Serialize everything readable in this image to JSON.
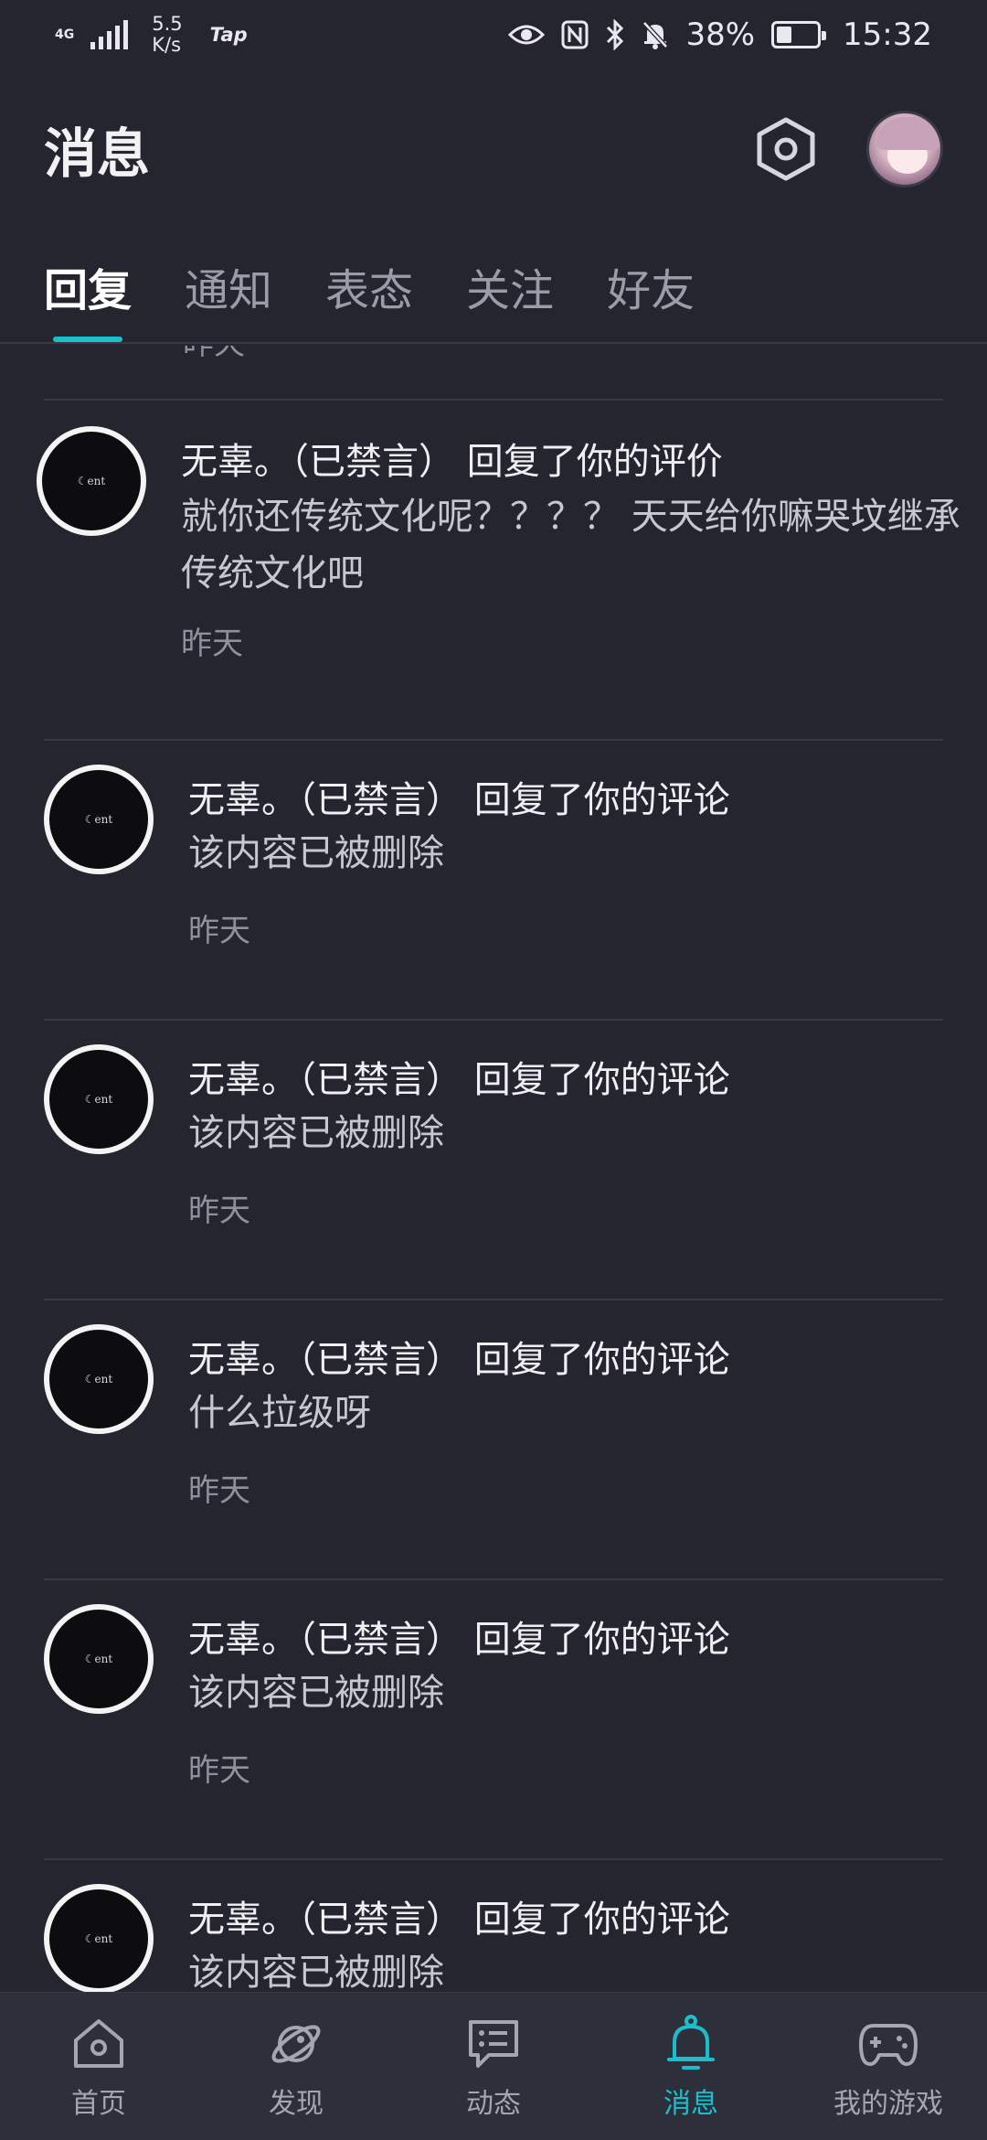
{
  "status_bar": {
    "network": "4G",
    "speed_value": "5.5",
    "speed_unit": "K/s",
    "app_badge": "Tap",
    "battery_percent": "38%",
    "battery_level": 0.38,
    "time": "15:32"
  },
  "header": {
    "title": "消息"
  },
  "tabs": [
    {
      "label": "回复",
      "active": true
    },
    {
      "label": "通知",
      "active": false
    },
    {
      "label": "表态",
      "active": false
    },
    {
      "label": "关注",
      "active": false
    },
    {
      "label": "好友",
      "active": false
    }
  ],
  "list": {
    "partial_time": "昨天",
    "items": [
      {
        "title": "无辜。（已禁言） 回复了你的评价",
        "body": "就你还传统文化呢？？？？ 天天给你嘛哭坟继承传统文化吧",
        "time": "昨天"
      },
      {
        "title": "无辜。（已禁言） 回复了你的评论",
        "body": "该内容已被删除",
        "time": "昨天"
      },
      {
        "title": "无辜。（已禁言） 回复了你的评论",
        "body": "该内容已被删除",
        "time": "昨天"
      },
      {
        "title": "无辜。（已禁言） 回复了你的评论",
        "body": "什么拉级呀",
        "time": "昨天"
      },
      {
        "title": "无辜。（已禁言） 回复了你的评论",
        "body": "该内容已被删除",
        "time": "昨天"
      },
      {
        "title": "无辜。（已禁言） 回复了你的评论",
        "body": "该内容已被删除",
        "time": ""
      }
    ]
  },
  "bottom_nav": [
    {
      "label": "首页",
      "icon": "home-icon",
      "active": false
    },
    {
      "label": "发现",
      "icon": "planet-icon",
      "active": false
    },
    {
      "label": "动态",
      "icon": "chat-bubble-icon",
      "active": false
    },
    {
      "label": "消息",
      "icon": "bell-icon",
      "active": true
    },
    {
      "label": "我的游戏",
      "icon": "gamepad-icon",
      "active": false
    }
  ],
  "colors": {
    "background": "#24252f",
    "accent": "#19c0cc",
    "nav_background": "#2d2f3b"
  }
}
